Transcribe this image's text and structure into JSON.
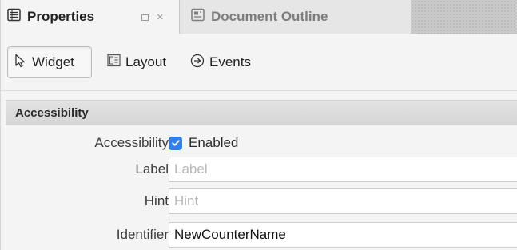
{
  "tabs": [
    {
      "label": "Properties",
      "active": true,
      "icon": "properties-list-icon"
    },
    {
      "label": "Document Outline",
      "active": false,
      "icon": "document-outline-icon"
    }
  ],
  "tab_controls": {
    "close_glyph": "×"
  },
  "toolbar": {
    "items": [
      {
        "label": "Widget",
        "icon": "cursor-arrow-icon",
        "selected": true
      },
      {
        "label": "Layout",
        "icon": "layout-grid-icon",
        "selected": false
      },
      {
        "label": "Events",
        "icon": "circled-arrow-icon",
        "selected": false
      }
    ]
  },
  "section": {
    "title": "Accessibility",
    "rows": {
      "accessibility": {
        "label": "Accessibility",
        "checkbox_label": "Enabled",
        "checked": true
      },
      "label": {
        "label": "Label",
        "value": "",
        "placeholder": "Label"
      },
      "hint": {
        "label": "Hint",
        "value": "",
        "placeholder": "Hint"
      },
      "identifier": {
        "label": "Identifier",
        "value": "NewCounterName",
        "placeholder": ""
      }
    }
  },
  "colors": {
    "accent": "#2f80ed",
    "panel_bg": "#f4f4f4",
    "section_header_bg": "#d9d9d9"
  }
}
